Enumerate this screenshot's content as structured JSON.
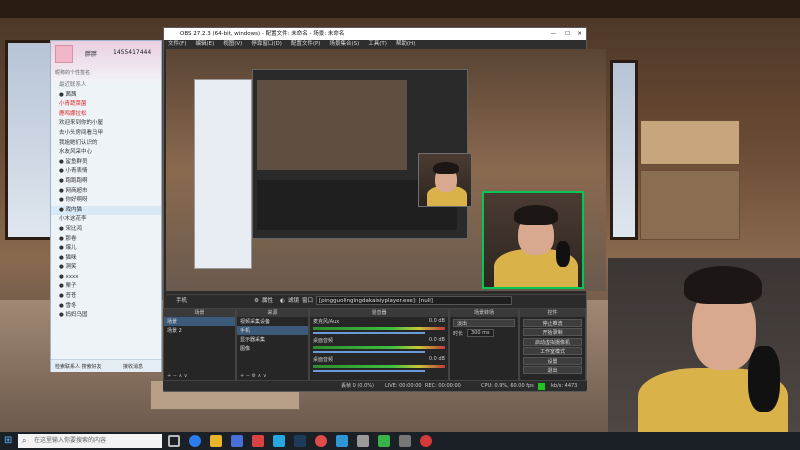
{
  "qq": {
    "nickname": "胖胖",
    "account": "1455417444",
    "sub_line": "昵称的个性签名",
    "section_label": "最近联系人",
    "rows": [
      {
        "label": "● 茜茜",
        "red": false
      },
      {
        "label": "小青蔬菜菌",
        "red": true
      },
      {
        "label": "鹿鸣娜拉松",
        "red": true
      },
      {
        "label": "欢迎来到你的小屋",
        "red": false
      },
      {
        "label": "去小头房间看马甲",
        "red": false
      },
      {
        "label": "我姐她们认识的",
        "red": false
      },
      {
        "label": "水友风采中心",
        "red": false
      },
      {
        "label": "● 鲨鱼群员",
        "red": false
      },
      {
        "label": "● 小青表情",
        "red": false
      },
      {
        "label": "● 跑跑跑啊",
        "red": false
      },
      {
        "label": "● 网商超市",
        "red": false
      },
      {
        "label": "● 你好啊呀",
        "red": false
      },
      {
        "label": "● 戏内猫",
        "red": false
      },
      {
        "label": "小木这花李",
        "red": false
      },
      {
        "label": "● 宋比鸿",
        "red": false
      },
      {
        "label": "● 那卷",
        "red": false
      },
      {
        "label": "● 爆儿",
        "red": false
      },
      {
        "label": "● 猫咪",
        "red": false
      },
      {
        "label": "● 洞笑",
        "red": false
      },
      {
        "label": "● xxxx",
        "red": false
      },
      {
        "label": "● 栗子",
        "red": false
      },
      {
        "label": "● 苍苍",
        "red": false
      },
      {
        "label": "● 雪冬",
        "red": false
      },
      {
        "label": "● 妈妈乌国",
        "red": false
      }
    ],
    "bottom_search": "检索联系人 搜索好友",
    "bottom_status": "接收消息"
  },
  "obs": {
    "title": "OBS 27.2.3 (64-bit, windows) - 配置文件: 未命名 - 场景: 未命名",
    "menu": [
      "文件(F)",
      "编辑(E)",
      "视图(V)",
      "停靠窗口(D)",
      "配置文件(P)",
      "场景集合(S)",
      "工具(T)",
      "帮助(H)"
    ],
    "source_bar_label": "手机",
    "props_label": "属性",
    "filters_label": "滤镜",
    "window_field": "窗口",
    "window_value": "[pingguolingingdakaisiyplayer.exe]: [null]",
    "docks": {
      "scenes_title": "场景",
      "scenes": [
        "场景",
        "场景 2"
      ],
      "sources_title": "来源",
      "sources": [
        "视频采集设备",
        "手机",
        "显示器采集",
        "图像"
      ],
      "mixer_title": "混音器",
      "mixer_tracks": [
        {
          "name": "麦克风/Aux",
          "db": "0.0 dB"
        },
        {
          "name": "桌面音频",
          "db": "0.0 dB"
        },
        {
          "name": "桌面音频",
          "db": "0.0 dB"
        }
      ],
      "transitions_title": "场景转场",
      "transition_value": "淡出",
      "duration_label": "时长",
      "duration_value": "300 ms",
      "controls_title": "控件",
      "controls": [
        "停止推流",
        "开始录制",
        "启动虚拟摄像机",
        "工作室模式",
        "设置",
        "退出"
      ]
    },
    "status": {
      "dropped": "丢帧 0 (0.0%)",
      "live": "LIVE: 00:00:00",
      "rec": "REC: 00:00:00",
      "cpu": "CPU: 0.9%, 60.00 fps",
      "kbps": "kb/s: 4473"
    }
  },
  "taskbar": {
    "search_placeholder": "在这里输入你要搜索的内容"
  },
  "colors": {
    "obs_bg": "#2b2b2b",
    "live_indicator": "#22c322",
    "qq_accent": "#d9241c",
    "webcam_border": "#00c853"
  },
  "icons": [
    "windows-start-icon",
    "search-icon",
    "task-view-icon",
    "edge-icon",
    "file-explorer-icon",
    "store-icon",
    "wechat-icon",
    "obs-icon",
    "qq-icon",
    "steam-icon"
  ]
}
